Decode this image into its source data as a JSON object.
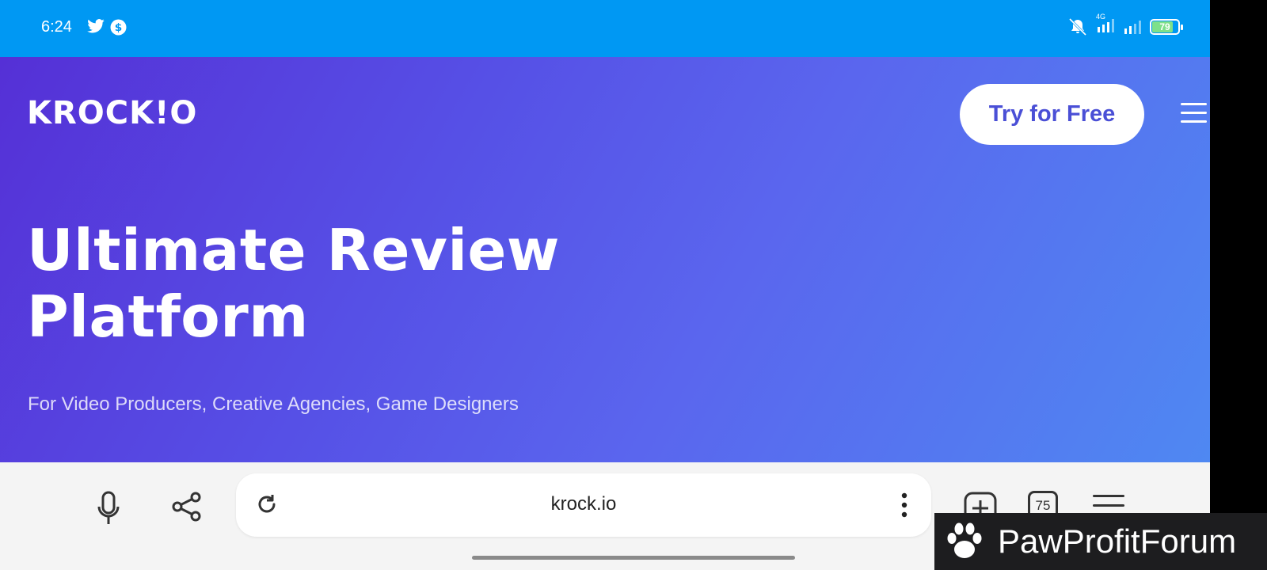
{
  "status_bar": {
    "time": "6:24",
    "battery": "79",
    "network": "4G",
    "icons": [
      "twitter-icon",
      "coin-icon",
      "mute-icon",
      "signal-icon",
      "signal-icon",
      "battery-icon"
    ]
  },
  "site": {
    "logo": "KROCK!O",
    "cta_label": "Try for Free",
    "headline_line1": "Ultimate Review",
    "headline_line2": "Platform",
    "subheadline": "For Video Producers, Creative Agencies, Game Designers"
  },
  "browser": {
    "url": "krock.io",
    "tab_count": "75"
  },
  "watermark": {
    "text": "PawProfitForum"
  },
  "colors": {
    "status_bar": "#0098f3",
    "hero_start": "#5530d6",
    "hero_end": "#4f88f2",
    "cta_text": "#4a4fd6",
    "browser_bar": "#f4f4f4"
  }
}
